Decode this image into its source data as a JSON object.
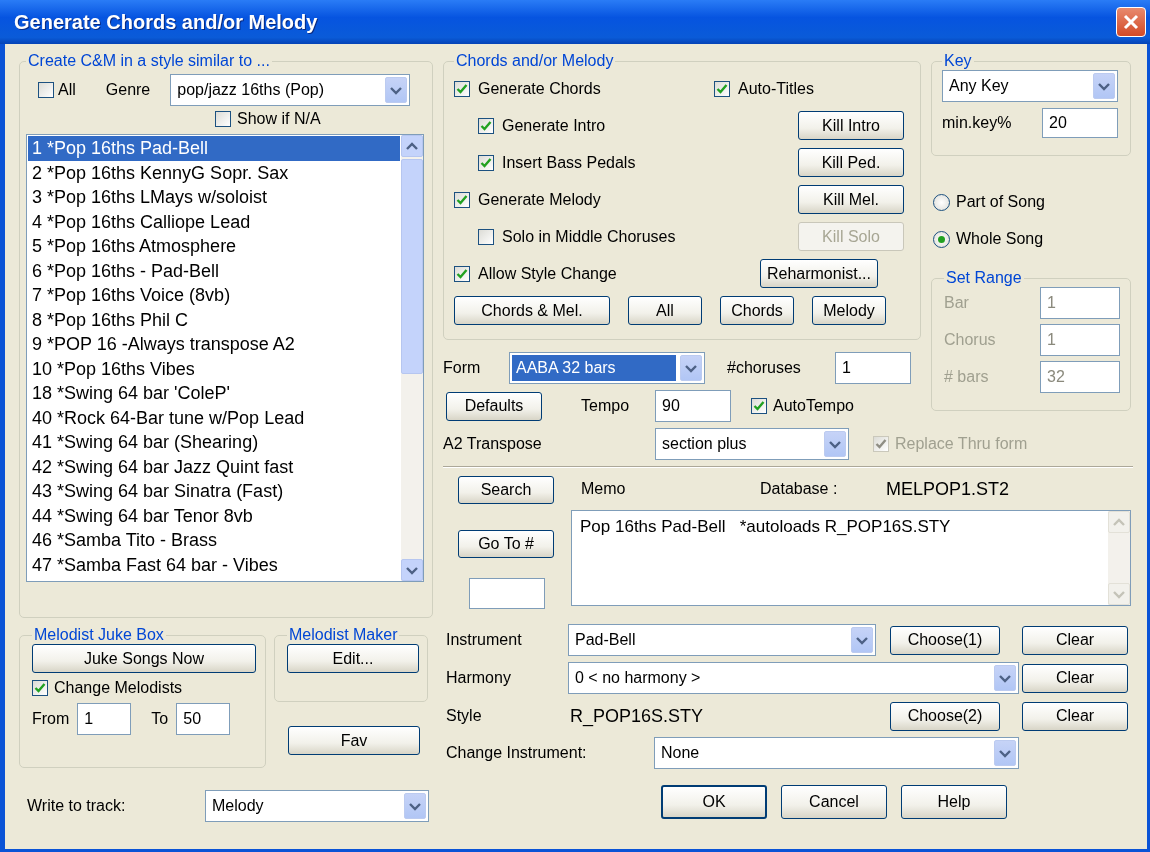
{
  "window": {
    "title": "Generate Chords and/or Melody"
  },
  "style_group": {
    "title": "Create C&M in a style similar to ...",
    "all": {
      "label": "All",
      "checked": false
    },
    "genre": {
      "label": "Genre",
      "value": "pop/jazz 16ths (Pop)"
    },
    "show_na": {
      "label": "Show if N/A",
      "checked": false
    },
    "styles": [
      {
        "label": "1 *Pop 16ths Pad-Bell",
        "selected": true
      },
      {
        "label": "2 *Pop 16ths KennyG Sopr. Sax",
        "selected": false
      },
      {
        "label": "3 *Pop 16ths LMays w/soloist",
        "selected": false
      },
      {
        "label": "4 *Pop 16ths Calliope Lead",
        "selected": false
      },
      {
        "label": "5 *Pop 16ths Atmosphere",
        "selected": false
      },
      {
        "label": "6 *Pop 16ths - Pad-Bell",
        "selected": false
      },
      {
        "label": "7 *Pop 16ths Voice (8vb)",
        "selected": false
      },
      {
        "label": "8 *Pop 16ths Phil C",
        "selected": false
      },
      {
        "label": "9 *POP 16 -Always transpose A2",
        "selected": false
      },
      {
        "label": "10 *Pop 16ths Vibes",
        "selected": false
      },
      {
        "label": "18 *Swing 64 bar 'ColeP'",
        "selected": false
      },
      {
        "label": "40 *Rock 64-Bar tune w/Pop Lead",
        "selected": false
      },
      {
        "label": "41 *Swing 64 bar (Shearing)",
        "selected": false
      },
      {
        "label": "42 *Swing 64 bar Jazz Quint fast",
        "selected": false
      },
      {
        "label": "43 *Swing 64 bar Sinatra (Fast)",
        "selected": false
      },
      {
        "label": "44 *Swing 64 bar Tenor 8vb",
        "selected": false
      },
      {
        "label": "46 *Samba Tito - Brass",
        "selected": false
      },
      {
        "label": "47 *Samba Fast 64 bar - Vibes",
        "selected": false
      }
    ]
  },
  "juke_box": {
    "title": "Melodist Juke Box",
    "button": "Juke Songs Now",
    "change": {
      "label": "Change Melodists",
      "checked": true
    },
    "from": {
      "label": "From",
      "value": "1"
    },
    "to": {
      "label": "To",
      "value": "50"
    }
  },
  "maker": {
    "title": "Melodist Maker",
    "button": "Edit..."
  },
  "fav": "Fav",
  "write_to_track": {
    "label": "Write to track:",
    "value": "Melody"
  },
  "chords_group": {
    "title": "Chords and/or Melody",
    "options": [
      {
        "label": "Generate Chords",
        "checked": true,
        "aside": {
          "label": "Auto-Titles",
          "checked": true
        },
        "children": [
          {
            "label": "Generate Intro",
            "checked": true,
            "button": {
              "label": "Kill Intro",
              "disabled": false
            }
          },
          {
            "label": "Insert Bass Pedals",
            "checked": true,
            "button": {
              "label": "Kill Ped.",
              "disabled": false
            }
          }
        ]
      },
      {
        "label": "Generate Melody",
        "checked": true,
        "button": {
          "label": "Kill Mel.",
          "disabled": false
        },
        "children": [
          {
            "label": "Solo in Middle Choruses",
            "checked": false,
            "button": {
              "label": "Kill Solo",
              "disabled": true
            }
          }
        ]
      },
      {
        "label": "Allow Style Change",
        "checked": true,
        "button": {
          "label": "Reharmonist...",
          "disabled": false
        }
      }
    ],
    "buttons": [
      "Chords & Mel.",
      "All",
      "Chords",
      "Melody"
    ]
  },
  "form": {
    "label": "Form",
    "value": "AABA 32 bars",
    "highlighted": true
  },
  "choruses": {
    "label": "#choruses",
    "value": "1"
  },
  "defaults": "Defaults",
  "tempo": {
    "label": "Tempo",
    "value": "90"
  },
  "auto_tempo": {
    "label": "AutoTempo",
    "checked": true
  },
  "transpose": {
    "label": "A2 Transpose",
    "value": "section plus"
  },
  "replace_thru": {
    "label": "Replace Thru form",
    "checked": true,
    "disabled": true
  },
  "key": {
    "title": "Key",
    "value": "Any Key",
    "min_label": "min.key%",
    "min_value": "20"
  },
  "scope": [
    {
      "label": "Part of Song",
      "selected": false
    },
    {
      "label": "Whole Song",
      "selected": true
    }
  ],
  "range": {
    "title": "Set Range",
    "disabled": true,
    "fields": [
      {
        "label": "Bar",
        "value": "1"
      },
      {
        "label": "Chorus",
        "value": "1"
      },
      {
        "label": "# bars",
        "value": "32"
      }
    ]
  },
  "search": "Search",
  "goto": "Go To #",
  "memo": {
    "label": "Memo",
    "text": "Pop 16ths Pad-Bell   *autoloads R_POP16S.STY"
  },
  "database": {
    "label": "Database :",
    "value": "MELPOP1.ST2"
  },
  "instrument": {
    "label": "Instrument",
    "value": "Pad-Bell",
    "choose": "Choose(1)",
    "clear": "Clear"
  },
  "harmony": {
    "label": "Harmony",
    "value": "0 < no harmony >",
    "clear": "Clear"
  },
  "style": {
    "label": "Style",
    "value": "R_POP16S.STY",
    "choose": "Choose(2)",
    "clear": "Clear"
  },
  "change_instrument": {
    "label": "Change Instrument:",
    "value": "None"
  },
  "footer": [
    "OK",
    "Cancel",
    "Help"
  ]
}
